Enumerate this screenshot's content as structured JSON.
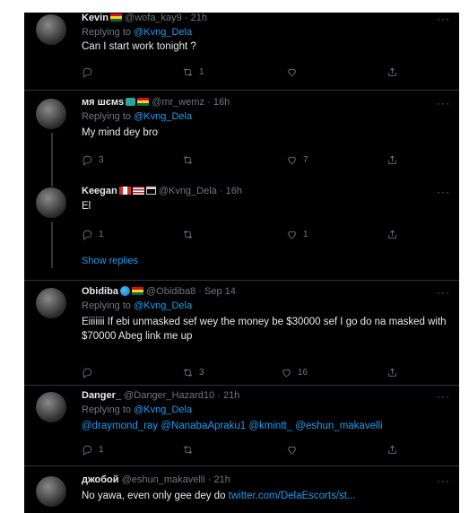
{
  "tweets": [
    {
      "name": "Kevin",
      "handle": "@wofa_kay9",
      "time": "21h",
      "reply_prefix": "Replying to",
      "reply_to": "@Kvng_Dela",
      "text": "Can I start work tonight ?",
      "replies": "",
      "retweets": "1",
      "likes": ""
    },
    {
      "name": "мя шємs",
      "handle": "@mr_wemz",
      "time": "16h",
      "reply_prefix": "Replying to",
      "reply_to": "@Kvng_Dela",
      "text": "My mind dey bro",
      "replies": "3",
      "retweets": "",
      "likes": "7"
    },
    {
      "name": "Keegan",
      "handle": "@Kvng_Dela",
      "time": "16h",
      "text": "El",
      "replies": "1",
      "retweets": "",
      "likes": "1",
      "show_replies": "Show replies"
    },
    {
      "name": "Obidiba",
      "handle": "@Obidiba8",
      "time": "Sep 14",
      "reply_prefix": "Replying to",
      "reply_to": "@Kvng_Dela",
      "text": "Eiiiiiii If ebi unmasked sef wey the money be $30000 sef I go do na masked with $70000 Abeg link me up",
      "replies": "",
      "retweets": "3",
      "likes": "16"
    },
    {
      "name": "Danger_",
      "handle": "@Danger_Hazard10",
      "time": "21h",
      "reply_prefix": "Replying to",
      "reply_to": "@Kvng_Dela",
      "text": "@draymond_ray @NanabaApraku1 @kmintt_ @eshun_makavelli",
      "replies": "1",
      "retweets": "",
      "likes": ""
    },
    {
      "name": "джобой",
      "handle": "@eshun_makavelli",
      "time": "21h",
      "text_plain": "No yawa, even only gee dey do ",
      "text_link": "twitter.com/DelaEscorts/st..."
    }
  ],
  "icons": {
    "reply": "reply-icon",
    "retweet": "retweet-icon",
    "like": "heart-icon",
    "share": "share-icon",
    "more": "more-icon"
  },
  "colors": {
    "background": "#000000",
    "text": "#e7e9ea",
    "muted": "#71767b",
    "accent": "#1d9bf0",
    "separator": "#2f3336"
  },
  "more_glyph": "···",
  "dot": "·"
}
